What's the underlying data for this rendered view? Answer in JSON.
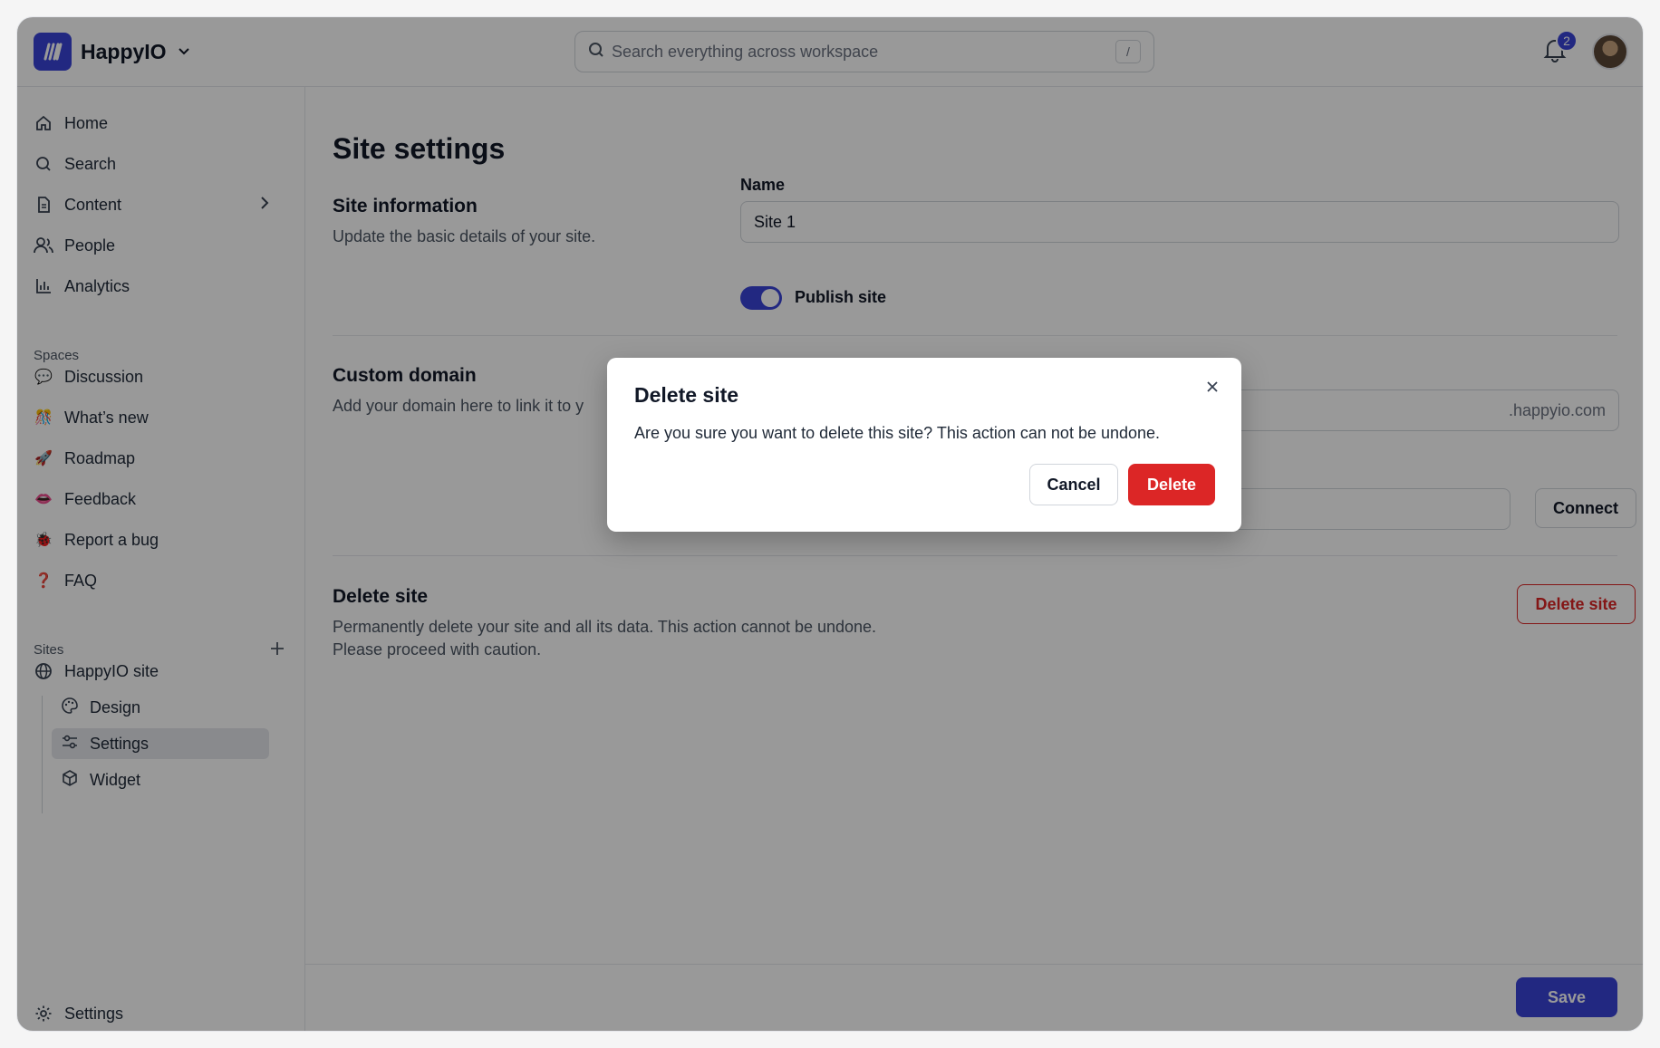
{
  "app": {
    "name": "HappyIO"
  },
  "search": {
    "placeholder": "Search everything across workspace",
    "shortcut": "/"
  },
  "notifications": {
    "count": "2"
  },
  "sidebar": {
    "nav": [
      {
        "label": "Home",
        "icon": "home-icon"
      },
      {
        "label": "Search",
        "icon": "search-icon"
      },
      {
        "label": "Content",
        "icon": "document-icon"
      },
      {
        "label": "People",
        "icon": "people-icon"
      },
      {
        "label": "Analytics",
        "icon": "bar-chart-icon"
      }
    ],
    "spaces_label": "Spaces",
    "spaces": [
      {
        "label": "Discussion",
        "icon": "💬"
      },
      {
        "label": "What’s new",
        "icon": "🎊"
      },
      {
        "label": "Roadmap",
        "icon": "🚀"
      },
      {
        "label": "Feedback",
        "icon": "👄"
      },
      {
        "label": "Report a bug",
        "icon": "🐞"
      },
      {
        "label": "FAQ",
        "icon": "❓"
      }
    ],
    "sites_label": "Sites",
    "site": {
      "label": "HappyIO site"
    },
    "site_children": [
      {
        "label": "Design"
      },
      {
        "label": "Settings"
      },
      {
        "label": "Widget"
      }
    ],
    "footer_settings": "Settings"
  },
  "main": {
    "title": "Site settings",
    "site_info": {
      "title": "Site information",
      "description": "Update the basic details of your site.",
      "name_label": "Name",
      "name_value": "Site 1",
      "publish_label": "Publish site",
      "publish_on": true
    },
    "custom_domain": {
      "title": "Custom domain",
      "description": "Add your domain here to link it to y",
      "suffix": ".happyio.com",
      "connect_label": "Connect"
    },
    "delete_site": {
      "title": "Delete site",
      "description_line1": "Permanently delete your site and all its data. This action cannot be undone.",
      "description_line2": "Please proceed with caution.",
      "button_label": "Delete site"
    },
    "save_label": "Save"
  },
  "modal": {
    "title": "Delete site",
    "body": "Are you sure you want to delete this site? This action can not be undone.",
    "cancel_label": "Cancel",
    "confirm_label": "Delete"
  },
  "colors": {
    "accent": "#3a44d8",
    "danger": "#dc2626"
  }
}
